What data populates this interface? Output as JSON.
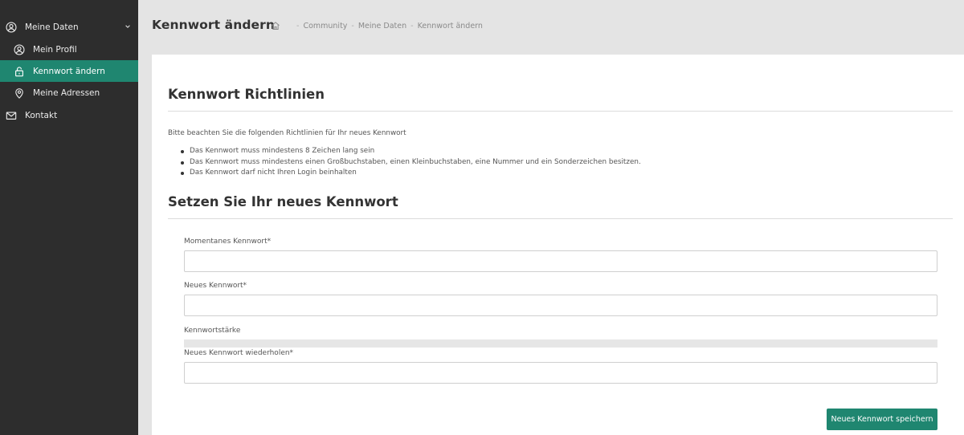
{
  "colors": {
    "sidebar_bg": "#2d2d2d",
    "accent": "#1f8670",
    "page_bg": "#e4e4e4"
  },
  "sidebar": {
    "section": {
      "label": "Meine Daten",
      "icon": "user-circle-icon",
      "expanded": true
    },
    "items": [
      {
        "label": "Mein Profil",
        "icon": "user-circle-icon",
        "active": false
      },
      {
        "label": "Kennwort ändern",
        "icon": "lock-icon",
        "active": true
      },
      {
        "label": "Meine Adressen",
        "icon": "map-pin-icon",
        "active": false
      }
    ],
    "contact": {
      "label": "Kontakt",
      "icon": "envelope-icon"
    }
  },
  "header": {
    "title": "Kennwort ändern",
    "breadcrumb": [
      "Community",
      "Meine Daten",
      "Kennwort ändern"
    ]
  },
  "policy": {
    "heading": "Kennwort Richtlinien",
    "intro": "Bitte beachten Sie die folgenden Richtlinien für Ihr neues Kennwort",
    "rules": [
      "Das Kennwort muss mindestens 8 Zeichen lang sein",
      "Das Kennwort muss mindestens einen Großbuchstaben, einen Kleinbuchstaben, eine Nummer und ein Sonderzeichen besitzen.",
      "Das Kennwort darf nicht Ihren Login beinhalten"
    ]
  },
  "form": {
    "heading": "Setzen Sie Ihr neues Kennwort",
    "current_label": "Momentanes Kennwort*",
    "current_value": "",
    "new_label": "Neues Kennwort*",
    "new_value": "",
    "strength_label": "Kennwortstärke",
    "strength_value": 0,
    "repeat_label": "Neues Kennwort wiederholen*",
    "repeat_value": "",
    "save_label": "Neues Kennwort speichern"
  }
}
